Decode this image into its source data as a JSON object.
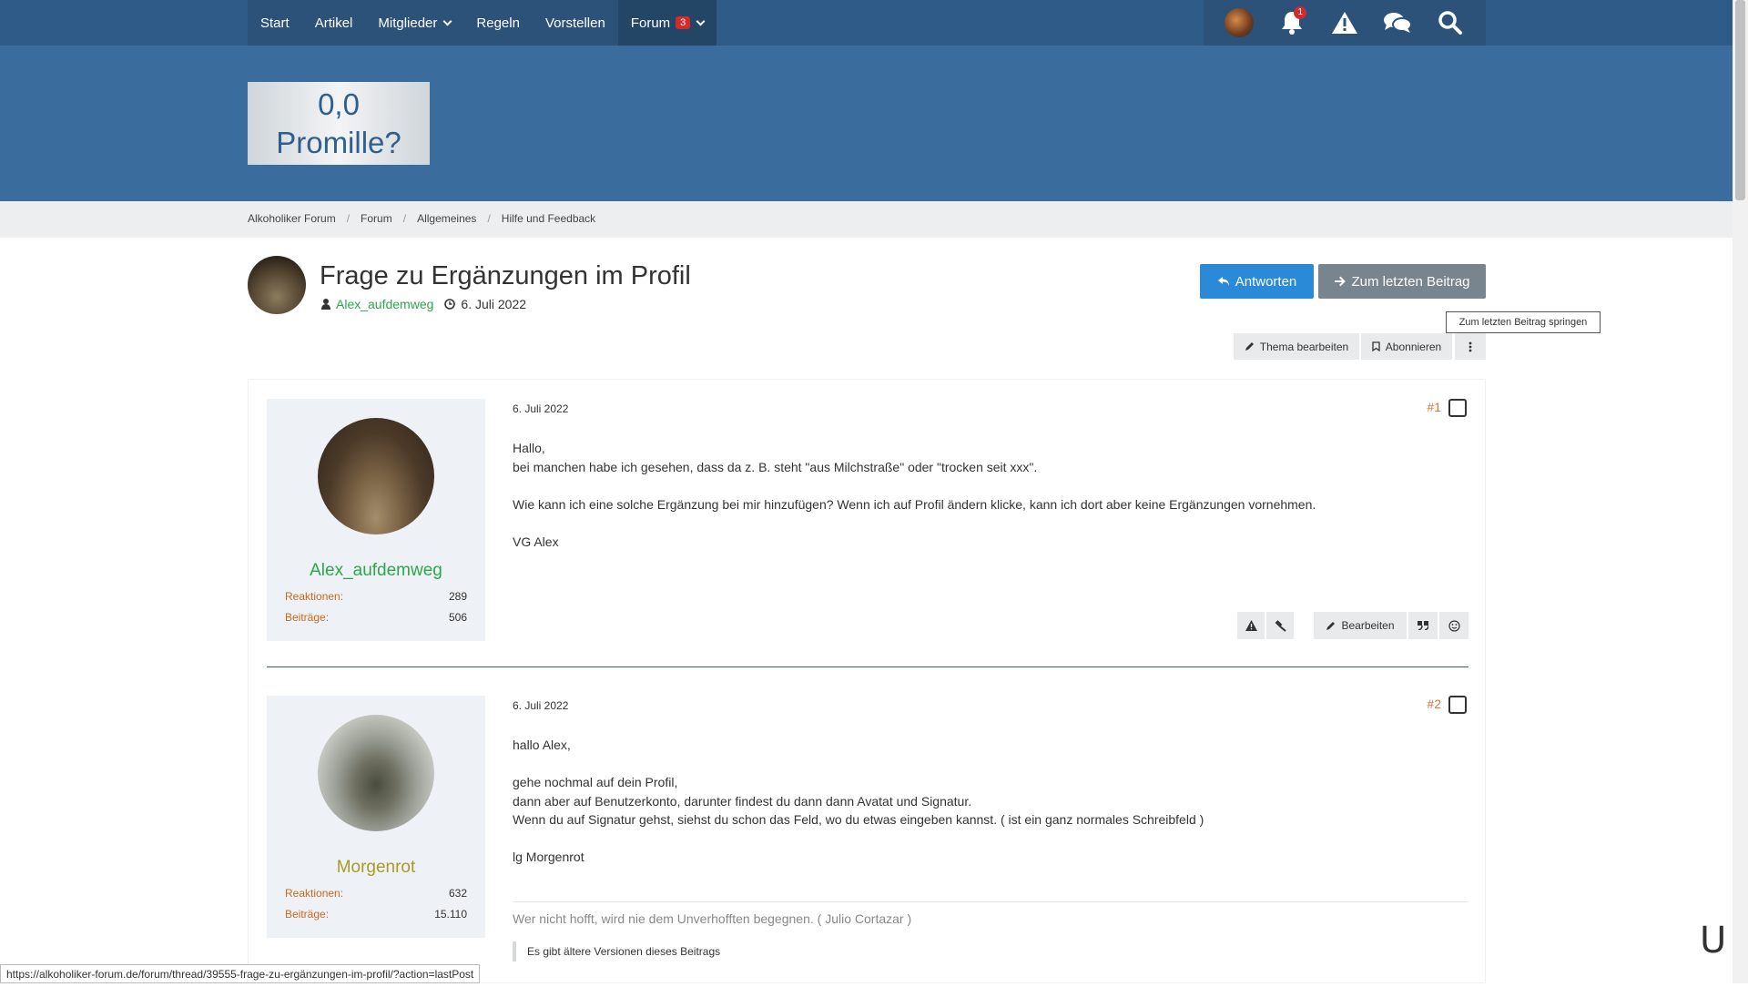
{
  "nav": {
    "items": [
      {
        "label": "Start"
      },
      {
        "label": "Artikel"
      },
      {
        "label": "Mitglieder"
      },
      {
        "label": "Regeln"
      },
      {
        "label": "Vorstellen"
      },
      {
        "label": "Forum",
        "badge": "3"
      }
    ],
    "notifications_count": "1"
  },
  "logo": {
    "line1": "0,0",
    "line2": "Promille?"
  },
  "breadcrumb": [
    "Alkoholiker Forum",
    "Forum",
    "Allgemeines",
    "Hilfe und Feedback"
  ],
  "thread": {
    "title": "Frage zu Ergänzungen im Profil",
    "author": "Alex_aufdemweg",
    "date": "6. Juli 2022"
  },
  "actions": {
    "reply": "Antworten",
    "last_post": "Zum letzten Beitrag",
    "tooltip": "Zum letzten Beitrag springen",
    "edit_thread": "Thema bearbeiten",
    "subscribe": "Abonnieren"
  },
  "labels": {
    "reactions": "Reaktionen:",
    "posts": "Beiträge:",
    "edit": "Bearbeiten"
  },
  "posts": [
    {
      "author": "Alex_aufdemweg",
      "author_color": "#2ea54a",
      "reactions": "289",
      "post_count": "506",
      "date": "6. Juli 2022",
      "number": "#1",
      "body": [
        "Hallo,",
        "bei manchen habe ich gesehen, dass da z. B. steht \"aus Milchstraße\" oder \"trocken seit xxx\".",
        "Wie kann ich eine solche Ergänzung bei mir hinzufügen? Wenn ich auf Profil ändern klicke, kann ich dort aber keine Ergänzungen vornehmen.",
        "VG Alex"
      ]
    },
    {
      "author": "Morgenrot",
      "author_color": "#a89a2a",
      "reactions": "632",
      "post_count": "15.110",
      "date": "6. Juli 2022",
      "number": "#2",
      "body": [
        "hallo Alex,",
        "gehe nochmal auf dein Profil,",
        "dann aber auf Benutzerkonto, darunter findest du dann dann Avatat und Signatur.",
        "Wenn du auf Signatur gehst, siehst du schon das Feld, wo du etwas eingeben kannst. ( ist ein ganz normales Schreibfeld )",
        "lg Morgenrot"
      ],
      "signature": "Wer nicht hofft, wird nie dem Unverhofften begegnen. ( Julio Cortazar )",
      "edits_note": "Es gibt ältere Versionen dieses Beitrags"
    }
  ],
  "statusbar_url": "https://alkoholiker-forum.de/forum/thread/39555-frage-zu-ergänzungen-im-profil/?action=lastPost"
}
